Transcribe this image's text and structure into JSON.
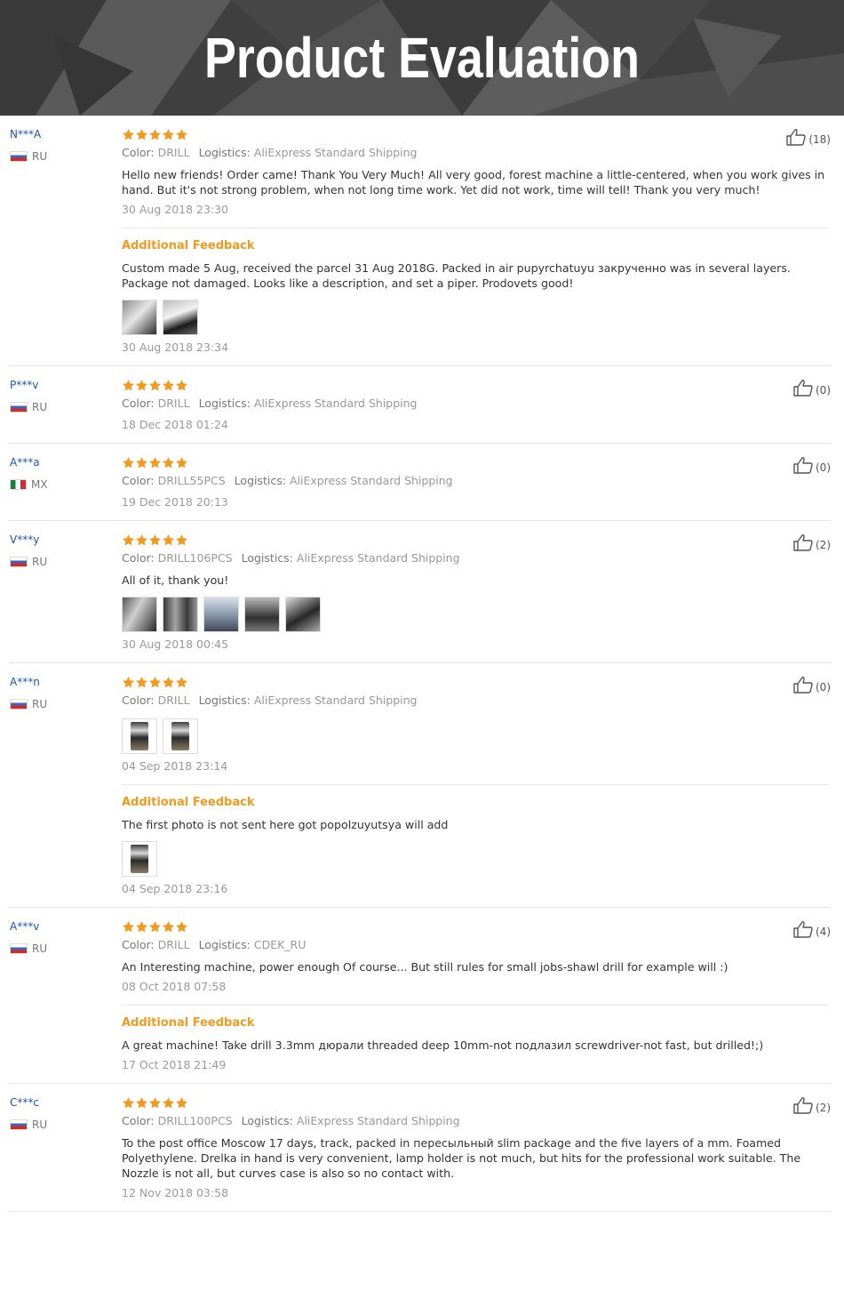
{
  "banner": {
    "title": "Product Evaluation"
  },
  "labels": {
    "color": "Color:",
    "logistics": "Logistics:",
    "additional_feedback": "Additional Feedback"
  },
  "reviews": [
    {
      "user": "N***A",
      "country": "RU",
      "flag": "ru",
      "stars": 5,
      "likes": "(18)",
      "color": "DRILL",
      "logistics": "AliExpress Standard Shipping",
      "text": "Hello new friends! Order came! Thank You Very Much! All very good, forest machine a little-centered, when you work gives in hand. But it's not strong problem, when not long time work. Yet did not work, time will tell! Thank you very much!",
      "date": "30 Aug 2018 23:30",
      "additional": {
        "text": "Custom made 5 Aug, received the parcel 31 Aug 2018G. Packed in air pupyrchatuyu закрученно was in several layers. Package not damaged. Looks like a description, and set a piper. Prodovets good!",
        "images": [
          "sq1",
          "sq2"
        ],
        "date": "30 Aug 2018 23:34"
      }
    },
    {
      "user": "P***v",
      "country": "RU",
      "flag": "ru",
      "stars": 5,
      "likes": "(0)",
      "color": "DRILL",
      "logistics": "AliExpress Standard Shipping",
      "text": "",
      "date": "18 Dec 2018 01:24"
    },
    {
      "user": "A***a",
      "country": "MX",
      "flag": "mx",
      "stars": 5,
      "likes": "(0)",
      "color": "DRILL55PCS",
      "logistics": "AliExpress Standard Shipping",
      "text": "",
      "date": "19 Dec 2018 20:13"
    },
    {
      "user": "V***y",
      "country": "RU",
      "flag": "ru",
      "stars": 5,
      "likes": "(2)",
      "color": "DRILL106PCS",
      "logistics": "AliExpress Standard Shipping",
      "text": "All of it, thank you!",
      "images": [
        "sq3",
        "sq4",
        "sq5",
        "sq6",
        "sq7"
      ],
      "date": "30 Aug 2018 00:45"
    },
    {
      "user": "A***n",
      "country": "RU",
      "flag": "ru",
      "stars": 5,
      "likes": "(0)",
      "color": "DRILL",
      "logistics": "AliExpress Standard Shipping",
      "text": "",
      "images": [
        "tall",
        "tall"
      ],
      "date": "04 Sep 2018 23:14",
      "additional": {
        "text": "The first photo is not sent here got popolzuyutsya will add",
        "images": [
          "tall"
        ],
        "date": "04 Sep 2018 23:16"
      }
    },
    {
      "user": "A***v",
      "country": "RU",
      "flag": "ru",
      "stars": 5,
      "likes": "(4)",
      "color": "DRILL",
      "logistics": "CDEK_RU",
      "text": "An Interesting machine, power enough Of course... But still rules for small jobs-shawl drill for example will :)",
      "date": "08 Oct 2018 07:58",
      "additional": {
        "text": "A great machine! Take drill 3.3mm дюрали threaded deep 10mm-not подлазил screwdriver-not fast, but drilled!;)",
        "images": [],
        "date": "17 Oct 2018 21:49"
      }
    },
    {
      "user": "C***c",
      "country": "RU",
      "flag": "ru",
      "stars": 5,
      "likes": "(2)",
      "color": "DRILL100PCS",
      "logistics": "AliExpress Standard Shipping",
      "text": "To the post office Moscow 17 days, track, packed in пересыльный slim package and the five layers of a mm. Foamed Polyethylene. Drelka in hand is very convenient, lamp holder is not much, but hits for the professional work suitable. The Nozzle is not all, but curves case is also so no contact with.",
      "date": "12 Nov 2018 03:58"
    }
  ]
}
